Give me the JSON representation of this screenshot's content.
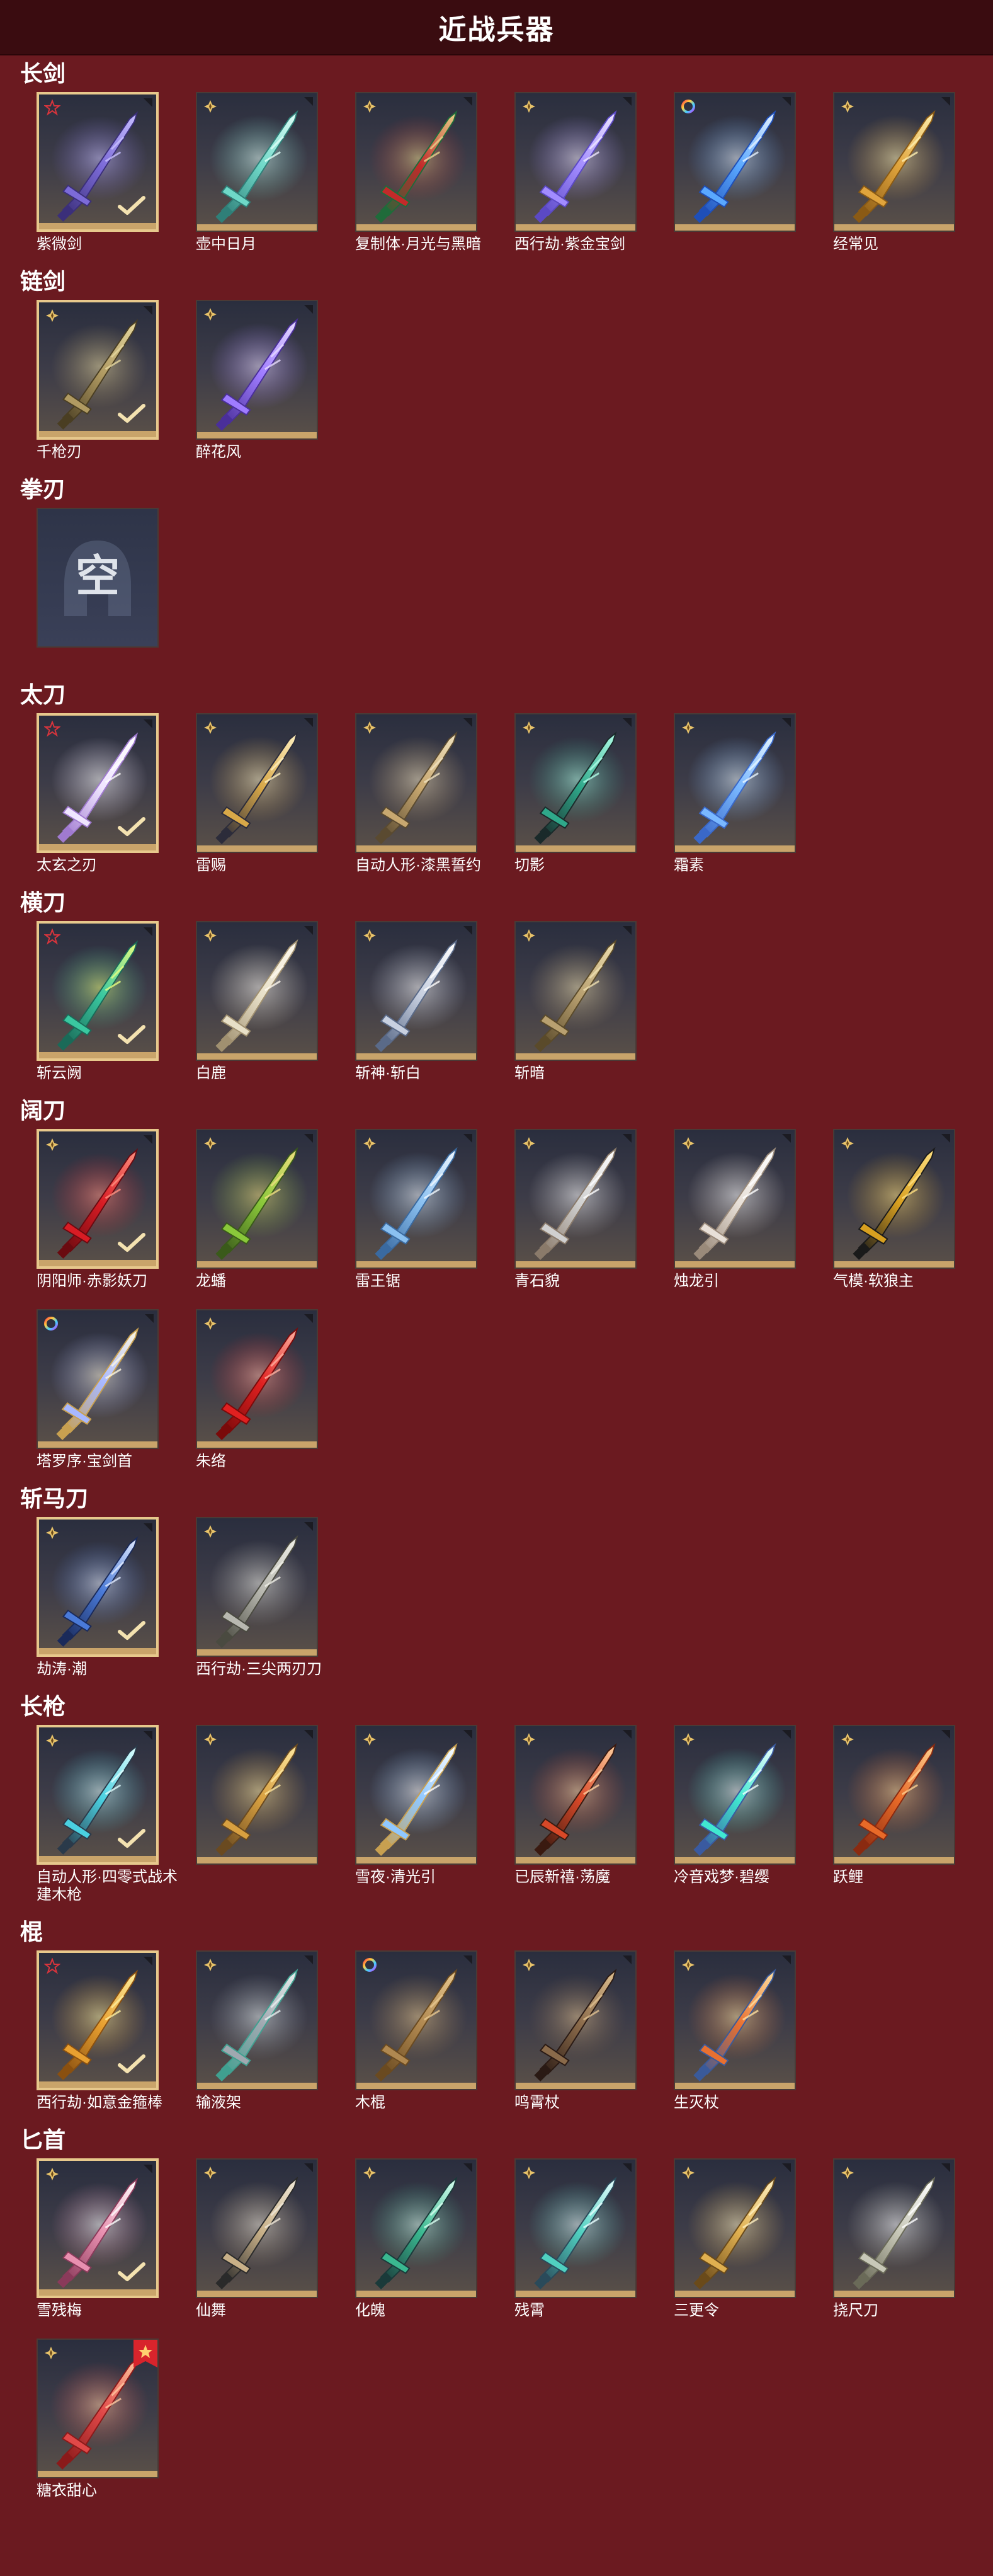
{
  "header": {
    "title": "近战兵器"
  },
  "empty_glyph": "空",
  "colors": {
    "background": "#6b1a20",
    "header": "#3a0c10",
    "selected_border": "#e7c88c",
    "card_bottom": "#c9a46a",
    "rarity_red": "#c0303a",
    "rarity_gold": "#e8c36a"
  },
  "sections": [
    {
      "title": "长剑",
      "items": [
        {
          "label": "紫微剑",
          "rarity": "red",
          "selected": true,
          "art": "purple-ornate"
        },
        {
          "label": "壶中日月",
          "rarity": "gold",
          "art": "teal-blade"
        },
        {
          "label": "复制体·月光与黑暗",
          "rarity": "gold",
          "art": "red-green-sword"
        },
        {
          "label": "西行劫·紫金宝剑",
          "rarity": "gold",
          "art": "violet-glow"
        },
        {
          "label": "",
          "rarity": "rainbow",
          "art": "blue-glow"
        },
        {
          "label": "经常见",
          "rarity": "gold",
          "art": "gold-ornate"
        }
      ]
    },
    {
      "title": "链剑",
      "items": [
        {
          "label": "千枪刃",
          "rarity": "gold",
          "selected": true,
          "art": "bronze-chain"
        },
        {
          "label": "醉花风",
          "rarity": "gold",
          "art": "purple-chain"
        }
      ]
    },
    {
      "title": "拳刃",
      "items": [
        {
          "label": "",
          "empty": true
        }
      ]
    },
    {
      "title": "太刀",
      "items": [
        {
          "label": "太玄之刃",
          "rarity": "red",
          "selected": true,
          "art": "white-spirit"
        },
        {
          "label": "雷赐",
          "rarity": "gold",
          "art": "gold-dark-blade"
        },
        {
          "label": "自动人形·漆黑誓约",
          "rarity": "gold",
          "art": "gold-slim"
        },
        {
          "label": "切影",
          "rarity": "gold",
          "art": "green-dark"
        },
        {
          "label": "霜素",
          "rarity": "gold",
          "art": "ice-blade"
        }
      ]
    },
    {
      "title": "横刀",
      "items": [
        {
          "label": "斩云阙",
          "rarity": "red",
          "selected": true,
          "art": "jade-glow"
        },
        {
          "label": "白鹿",
          "rarity": "gold",
          "art": "white-horn"
        },
        {
          "label": "斩神·斩白",
          "rarity": "gold",
          "art": "silver-spark"
        },
        {
          "label": "斩暗",
          "rarity": "gold",
          "art": "bronze-pair"
        }
      ]
    },
    {
      "title": "阔刀",
      "items": [
        {
          "label": "阴阳师·赤影妖刀",
          "rarity": "gold",
          "selected": true,
          "art": "crimson-blade"
        },
        {
          "label": "龙蟠",
          "rarity": "gold",
          "art": "green-gold-broad"
        },
        {
          "label": "雷王锯",
          "rarity": "gold",
          "art": "ice-broad"
        },
        {
          "label": "青石貌",
          "rarity": "gold",
          "art": "silver-broad"
        },
        {
          "label": "烛龙引",
          "rarity": "gold",
          "art": "white-dragon"
        },
        {
          "label": "气模·软狼主",
          "rarity": "gold",
          "art": "black-gold"
        },
        {
          "label": "塔罗序·宝剑首",
          "rarity": "rainbow",
          "art": "holy-glow"
        },
        {
          "label": "朱络",
          "rarity": "gold",
          "art": "red-crystal"
        }
      ]
    },
    {
      "title": "斩马刀",
      "items": [
        {
          "label": "劫涛·潮",
          "rarity": "gold",
          "selected": true,
          "art": "blue-curve"
        },
        {
          "label": "西行劫·三尖两刃刀",
          "rarity": "gold",
          "art": "silver-trident"
        }
      ]
    },
    {
      "title": "长枪",
      "items": [
        {
          "label": "自动人形·四零式战术建木枪",
          "rarity": "gold",
          "selected": true,
          "art": "cyan-spear"
        },
        {
          "label": "",
          "rarity": "gold",
          "art": "gold-spear"
        },
        {
          "label": "雪夜·清光引",
          "rarity": "gold",
          "art": "ice-spear"
        },
        {
          "label": "已辰新禧·荡魔",
          "rarity": "gold",
          "art": "red-fire-spear"
        },
        {
          "label": "冷音戏梦·碧缨",
          "rarity": "gold",
          "art": "cyan-tassel"
        },
        {
          "label": "跃鲤",
          "rarity": "gold",
          "art": "orange-fish"
        }
      ]
    },
    {
      "title": "棍",
      "items": [
        {
          "label": "西行劫·如意金箍棒",
          "rarity": "red",
          "selected": true,
          "art": "gold-staff"
        },
        {
          "label": "输液架",
          "rarity": "gold",
          "art": "iv-stand"
        },
        {
          "label": "木棍",
          "rarity": "rainbow",
          "art": "wood-stick"
        },
        {
          "label": "鸣霄杖",
          "rarity": "gold",
          "art": "dark-staff"
        },
        {
          "label": "生灭杖",
          "rarity": "gold",
          "art": "fire-staff"
        }
      ]
    },
    {
      "title": "匕首",
      "items": [
        {
          "label": "雪残梅",
          "rarity": "gold",
          "selected": true,
          "art": "pink-dagger"
        },
        {
          "label": "仙舞",
          "rarity": "gold",
          "art": "dark-dagger"
        },
        {
          "label": "化魄",
          "rarity": "gold",
          "art": "green-curved"
        },
        {
          "label": "残霄",
          "rarity": "gold",
          "art": "cyan-curved"
        },
        {
          "label": "三更令",
          "rarity": "gold",
          "art": "gold-dagger"
        },
        {
          "label": "挠尺刀",
          "rarity": "gold",
          "art": "silver-dagger"
        },
        {
          "label": "糖衣甜心",
          "rarity": "gold",
          "new_badge": "new",
          "art": "candy"
        }
      ]
    }
  ]
}
